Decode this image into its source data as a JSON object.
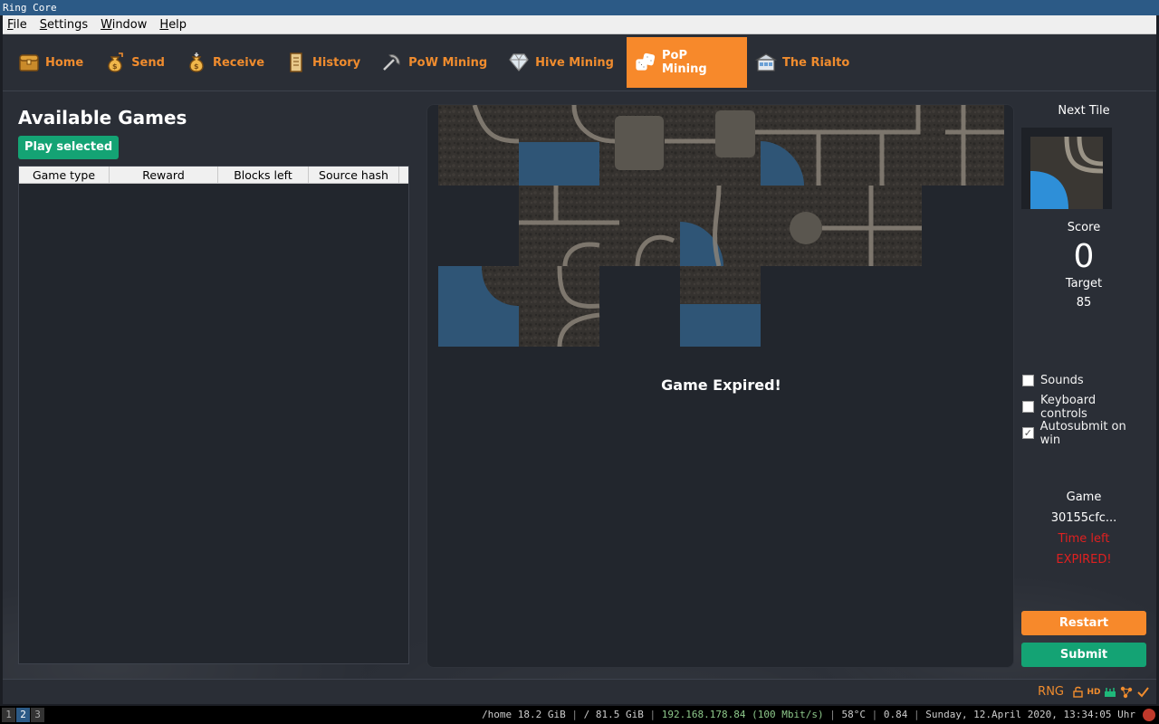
{
  "window": {
    "title": "Ring Core"
  },
  "menu": [
    "File",
    "Settings",
    "Window",
    "Help"
  ],
  "nav": {
    "tabs": [
      {
        "label": "Home",
        "icon": "treasure-chest-icon",
        "active": false
      },
      {
        "label": "Send",
        "icon": "money-bag-send-icon",
        "active": false
      },
      {
        "label": "Receive",
        "icon": "money-bag-receive-icon",
        "active": false
      },
      {
        "label": "History",
        "icon": "scroll-icon",
        "active": false
      },
      {
        "label": "PoW Mining",
        "icon": "pickaxe-icon",
        "active": false
      },
      {
        "label": "Hive Mining",
        "icon": "diamond-icon",
        "active": false
      },
      {
        "label": "PoP Mining",
        "icon": "dice-icon",
        "active": true
      },
      {
        "label": "The Rialto",
        "icon": "marketplace-icon",
        "active": false
      }
    ]
  },
  "games": {
    "title": "Available Games",
    "play_button": "Play selected",
    "columns": [
      "Game type",
      "Reward",
      "Blocks left",
      "Source hash"
    ],
    "rows": []
  },
  "board": {
    "message": "Game Expired!"
  },
  "side": {
    "next_tile_label": "Next Tile",
    "score_label": "Score",
    "score_value": "0",
    "target_label": "Target",
    "target_value": "85",
    "options": [
      {
        "label": "Sounds",
        "checked": false
      },
      {
        "label": "Keyboard controls",
        "checked": false
      },
      {
        "label": "Autosubmit on win",
        "checked": true
      }
    ],
    "game_label": "Game",
    "game_id": "30155cfc...",
    "time_left_label": "Time left",
    "time_left_value": "EXPIRED!",
    "restart_button": "Restart",
    "submit_button": "Submit"
  },
  "statusbar": {
    "ticker": "RNG",
    "icons": [
      "lock-open-icon",
      "hd-icon",
      "network-icon",
      "nodes-icon",
      "checkmark-icon"
    ]
  },
  "taskbar": {
    "workspaces": [
      "1",
      "2",
      "3"
    ],
    "active_workspace": "2",
    "home_disk": "/home 18.2 GiB",
    "root_disk": "/ 81.5 GiB",
    "ip": "192.168.178.84 (100 Mbit/s)",
    "temp": "58°C",
    "load": "0.84",
    "datetime": "Sunday, 12.April 2020, 13:34:05 Uhr"
  },
  "colors": {
    "accent_orange": "#f7892b",
    "accent_green": "#14a374",
    "expired_red": "#e02020",
    "background": "#2a2e36"
  }
}
